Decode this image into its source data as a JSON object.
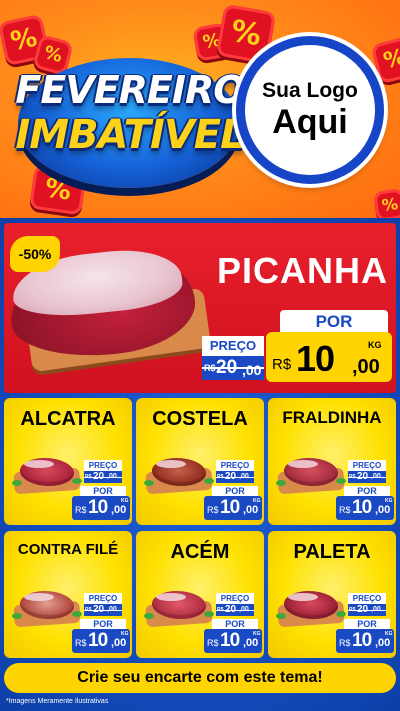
{
  "header": {
    "title_line1": "FEVEREIRO",
    "title_line2": "IMBATÍVEL",
    "percent_symbol": "%",
    "logo_line1": "Sua Logo",
    "logo_line2": "Aqui"
  },
  "hero": {
    "discount_badge": "-50%",
    "product_name": "PICANHA",
    "old_price_label": "PREÇO",
    "old_price": {
      "currency": "R$",
      "integer": "20",
      "decimals": ",00"
    },
    "new_price_label": "POR",
    "new_price": {
      "currency": "R$",
      "integer": "10",
      "decimals": ",00",
      "unit": "KG"
    }
  },
  "products": [
    {
      "name": "ALCATRA",
      "old_label": "PREÇO",
      "old_currency": "R$",
      "old_int": "20",
      "old_dec": ",00",
      "new_label": "POR",
      "new_currency": "R$",
      "new_int": "10",
      "new_dec": ",00",
      "unit": "KG"
    },
    {
      "name": "COSTELA",
      "old_label": "PREÇO",
      "old_currency": "R$",
      "old_int": "20",
      "old_dec": ",00",
      "new_label": "POR",
      "new_currency": "R$",
      "new_int": "10",
      "new_dec": ",00",
      "unit": "KG"
    },
    {
      "name": "FRALDINHA",
      "old_label": "PREÇO",
      "old_currency": "R$",
      "old_int": "20",
      "old_dec": ",00",
      "new_label": "POR",
      "new_currency": "R$",
      "new_int": "10",
      "new_dec": ",00",
      "unit": "KG"
    },
    {
      "name": "CONTRA FILÉ",
      "old_label": "PREÇO",
      "old_currency": "R$",
      "old_int": "20",
      "old_dec": ",00",
      "new_label": "POR",
      "new_currency": "R$",
      "new_int": "10",
      "new_dec": ",00",
      "unit": "KG"
    },
    {
      "name": "ACÉM",
      "old_label": "PREÇO",
      "old_currency": "R$",
      "old_int": "20",
      "old_dec": ",00",
      "new_label": "POR",
      "new_currency": "R$",
      "new_int": "10",
      "new_dec": ",00",
      "unit": "KG"
    },
    {
      "name": "PALETA",
      "old_label": "PREÇO",
      "old_currency": "R$",
      "old_int": "20",
      "old_dec": ",00",
      "new_label": "POR",
      "new_currency": "R$",
      "new_int": "10",
      "new_dec": ",00",
      "unit": "KG"
    }
  ],
  "footer": {
    "cta_label": "Crie seu encarte com este tema!",
    "disclaimer": "*Imagens Meramente Ilustrativas"
  },
  "colors": {
    "brand_blue": "#1a49c4",
    "accent_yellow": "#ffd400",
    "hero_red": "#e01222",
    "header_orange": "#ff8a1a"
  }
}
